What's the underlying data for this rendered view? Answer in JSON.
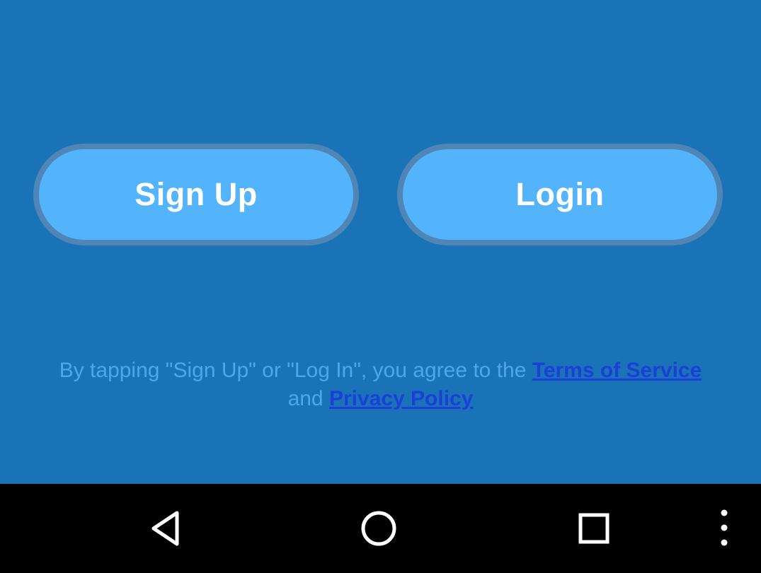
{
  "buttons": {
    "signup_label": "Sign Up",
    "login_label": "Login"
  },
  "terms": {
    "prefix": "By tapping \"Sign Up\" or \"Log In\", you agree to the ",
    "tos_link": "Terms of Service",
    "middle": "and ",
    "privacy_link": "Privacy Policy"
  },
  "nav": {
    "back_icon": "back-triangle-icon",
    "home_icon": "home-circle-icon",
    "recents_icon": "recents-square-icon",
    "menu_icon": "overflow-menu-icon"
  },
  "colors": {
    "background": "#1a73b6",
    "button_fill": "#53b4fb",
    "button_border": "#4f86b6",
    "terms_text": "#4fa6e8",
    "link": "#1b3fd9",
    "navbar": "#000000"
  }
}
